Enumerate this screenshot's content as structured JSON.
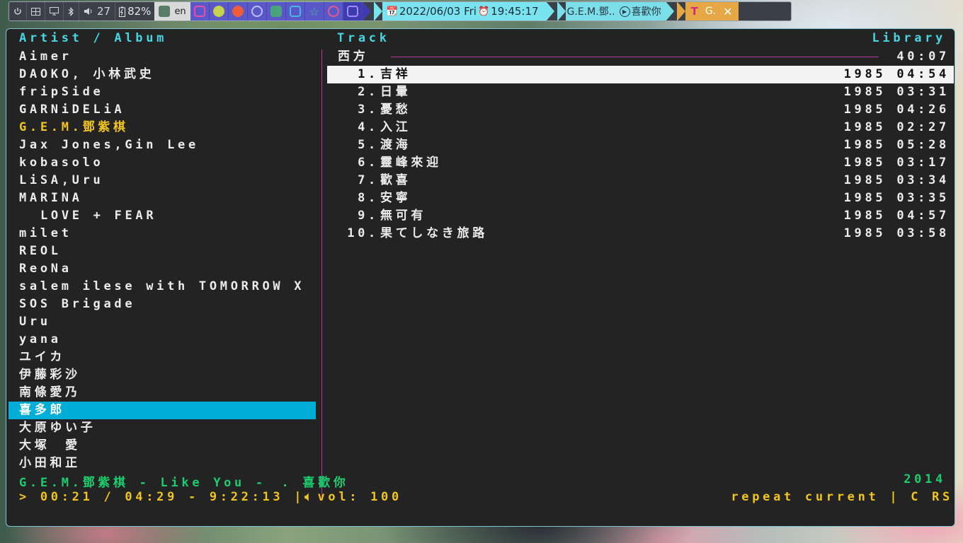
{
  "topbar": {
    "volume": "27",
    "battery": "82%",
    "keyboard_layout": "en",
    "datetime": "2022/06/03 Fri",
    "clock": "19:45:17",
    "now_playing": "G.E.M.鄧..",
    "now_playing_title": "喜歡你",
    "active_tab_label": "G.",
    "active_tab_close": "✕",
    "accent_cyan": "#79e3ef",
    "accent_orange": "#e6a845",
    "app_strip_color": "#5a57c8"
  },
  "headers": {
    "left": "Artist / Album",
    "middle": "Track",
    "right": "Library"
  },
  "artists": [
    {
      "name": "Aimer"
    },
    {
      "name": "DAOKO, 小林武史"
    },
    {
      "name": "fripSide"
    },
    {
      "name": "GARNiDELiA"
    },
    {
      "name": "G.E.M.鄧紫棋",
      "state": "current"
    },
    {
      "name": "Jax Jones,Gin Lee"
    },
    {
      "name": "kobasolo"
    },
    {
      "name": "LiSA,Uru"
    },
    {
      "name": "MARINA"
    },
    {
      "name": "LOVE + FEAR",
      "state": "album"
    },
    {
      "name": "milet"
    },
    {
      "name": "REOL"
    },
    {
      "name": "ReoNa"
    },
    {
      "name": "salem ilese with TOMORROW X"
    },
    {
      "name": "SOS Brigade"
    },
    {
      "name": "Uru"
    },
    {
      "name": "yana"
    },
    {
      "name": "ユイカ"
    },
    {
      "name": "伊藤彩沙"
    },
    {
      "name": "南條愛乃"
    },
    {
      "name": "喜多郎",
      "state": "selected"
    },
    {
      "name": "大原ゆい子"
    },
    {
      "name": "大塚　愛"
    },
    {
      "name": "小田和正"
    }
  ],
  "album": {
    "title": "西方",
    "duration": "40:07"
  },
  "tracks": [
    {
      "num": "1.",
      "title": "吉祥",
      "year": "1985",
      "duration": "04:54",
      "selected": true
    },
    {
      "num": "2.",
      "title": "日暈",
      "year": "1985",
      "duration": "03:31"
    },
    {
      "num": "3.",
      "title": "憂愁",
      "year": "1985",
      "duration": "04:26"
    },
    {
      "num": "4.",
      "title": "入江",
      "year": "1985",
      "duration": "02:27"
    },
    {
      "num": "5.",
      "title": "渡海",
      "year": "1985",
      "duration": "05:28"
    },
    {
      "num": "6.",
      "title": "靈峰來迎",
      "year": "1985",
      "duration": "03:17"
    },
    {
      "num": "7.",
      "title": "歡喜",
      "year": "1985",
      "duration": "03:34"
    },
    {
      "num": "8.",
      "title": "安寧",
      "year": "1985",
      "duration": "03:35"
    },
    {
      "num": "9.",
      "title": "無可有",
      "year": "1985",
      "duration": "04:57"
    },
    {
      "num": "10.",
      "title": "果てしなき旅路",
      "year": "1985",
      "duration": "03:58"
    }
  ],
  "status": {
    "now_playing": "G.E.M.鄧紫棋 - Like You -　. 喜歡你",
    "year": "2014",
    "progress": "> 00:21 / 04:29 - 9:22:13 |",
    "volume": "vol: 100",
    "mode": "repeat current | C RS",
    "color_green": "#1ccd6e",
    "color_yellow": "#f0c51e",
    "color_cyan": "#47d6e1",
    "color_selection": "#00aed8"
  }
}
